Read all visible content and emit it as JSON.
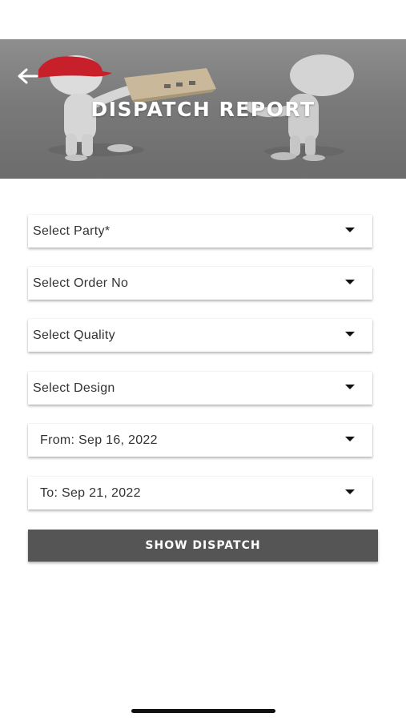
{
  "header": {
    "title": "DISPATCH REPORT",
    "back_icon": "arrow-left-icon"
  },
  "form": {
    "party": {
      "label": "Select Party*",
      "icon": "chevron-down-icon"
    },
    "order_no": {
      "label": "Select Order No",
      "icon": "chevron-down-icon"
    },
    "quality": {
      "label": "Select Quality",
      "icon": "chevron-down-icon"
    },
    "design": {
      "label": "Select Design",
      "icon": "chevron-down-icon"
    },
    "from_date": {
      "label": "From: Sep 16, 2022",
      "icon": "chevron-down-icon"
    },
    "to_date": {
      "label": "To: Sep 21, 2022",
      "icon": "chevron-down-icon"
    },
    "submit_label": "SHOW DISPATCH"
  },
  "colors": {
    "header_bg": "#7a7a7a",
    "button_bg": "#555555",
    "text": "#333333",
    "cap_red": "#c8202a"
  }
}
